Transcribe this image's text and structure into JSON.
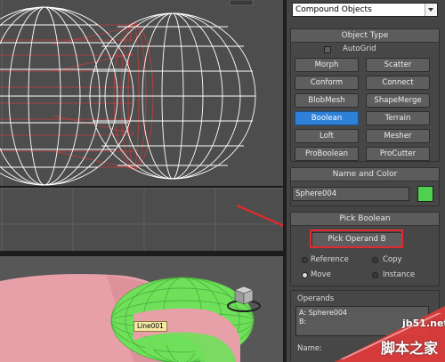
{
  "command_panel": {
    "category_dropdown": "Compound Objects",
    "object_type": {
      "title": "Object Type",
      "autogrid_label": "AutoGrid",
      "buttons": [
        "Morph",
        "Scatter",
        "Conform",
        "Connect",
        "BlobMesh",
        "ShapeMerge",
        "Boolean",
        "Terrain",
        "Loft",
        "Mesher",
        "ProBoolean",
        "ProCutter"
      ],
      "active_button": "Boolean"
    },
    "name_and_color": {
      "title": "Name and Color",
      "object_name": "Sphere004",
      "color": "#4fd04f"
    },
    "pick_boolean": {
      "title": "Pick Boolean",
      "pick_button": "Pick Operand B",
      "options": [
        "Reference",
        "Copy",
        "Move",
        "Instance"
      ],
      "selected_option": "Move"
    },
    "parameters": {
      "operands_title": "Operands",
      "operand_a": "A: Sphere004",
      "operand_b": "B:",
      "name_label": "Name:"
    }
  },
  "viewport": {
    "object_label": "Line001"
  },
  "watermark": {
    "url": "jb51.net",
    "site_name": "脚本之家"
  },
  "colors": {
    "panel_bg": "#444444",
    "active_button": "#2e80d8",
    "highlight_red": "#e2292e",
    "wire_white": "#ffffff",
    "wire_red": "#d63a3a",
    "pink_object": "#e8a0a8",
    "green_object": "#6ee05a"
  }
}
